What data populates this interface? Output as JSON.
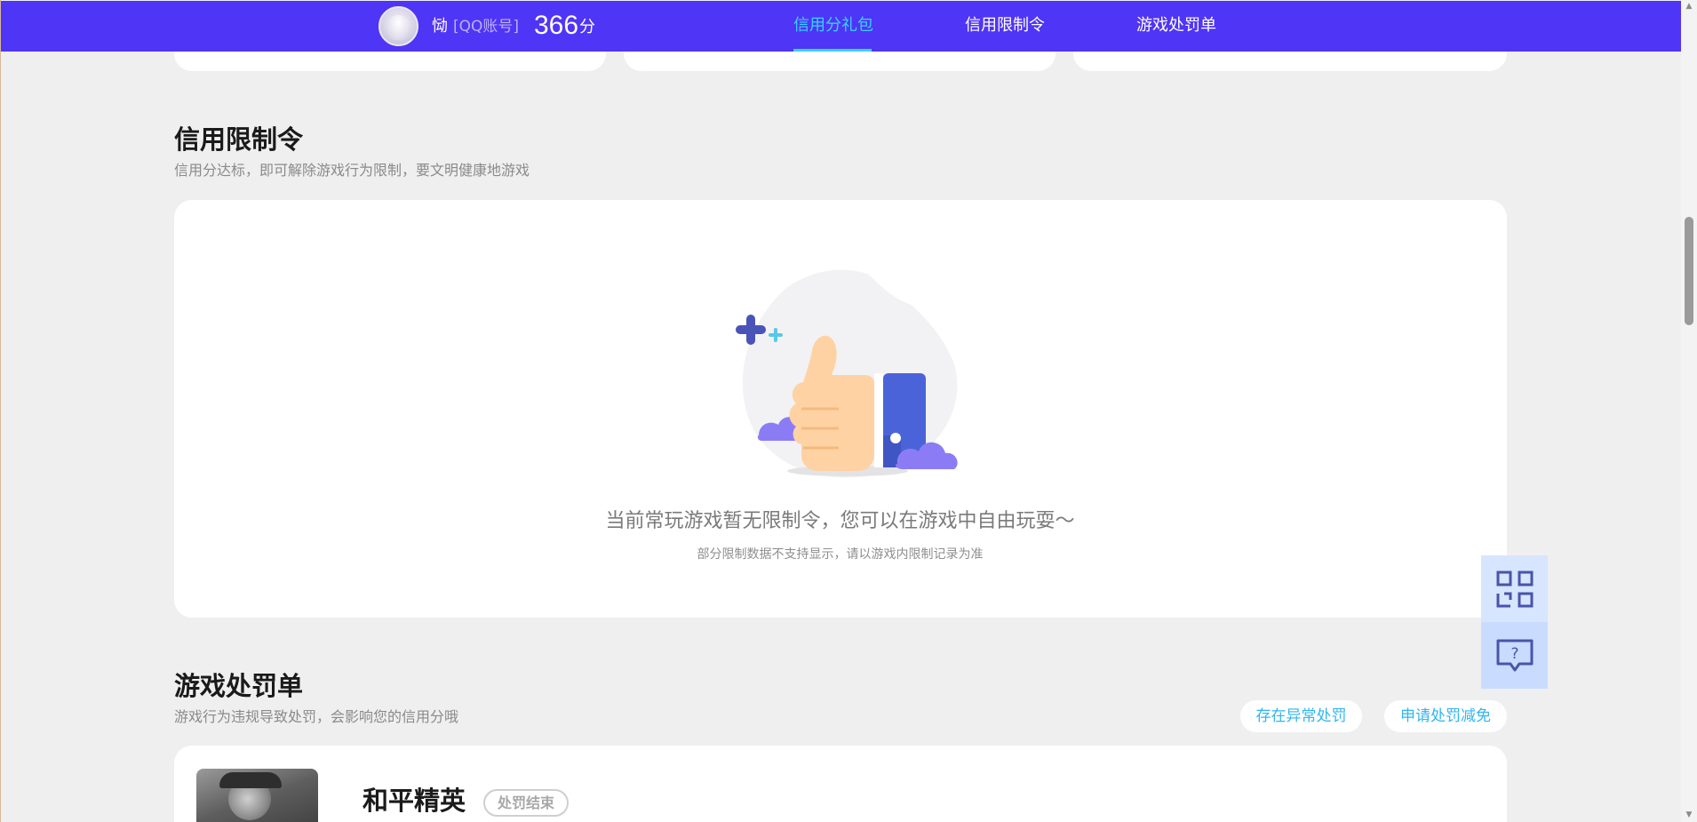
{
  "header": {
    "user_name": "恸",
    "account_type": "[QQ账号]",
    "score": "366",
    "score_unit": "分",
    "tabs": [
      {
        "label": "信用分礼包",
        "active": true
      },
      {
        "label": "信用限制令",
        "active": false
      },
      {
        "label": "游戏处罚单",
        "active": false
      }
    ]
  },
  "restriction_section": {
    "title": "信用限制令",
    "subtitle": "信用分达标，即可解除游戏行为限制，要文明健康地游戏",
    "empty_message": "当前常玩游戏暂无限制令，您可以在游戏中自由玩耍～",
    "empty_note": "部分限制数据不支持显示，请以游戏内限制记录为准"
  },
  "penalty_section": {
    "title": "游戏处罚单",
    "subtitle": "游戏行为违规导致处罚，会影响您的信用分哦",
    "abnormal_button": "存在异常处罚",
    "reduce_button": "申请处罚减免",
    "games": [
      {
        "name": "和平精英",
        "status": "处罚结束"
      }
    ]
  },
  "side_buttons": {
    "qr_icon": "qr-code-icon",
    "help_icon": "help-chat-icon"
  },
  "colors": {
    "header_bg": "#4f35f5",
    "accent": "#37d3ff",
    "link": "#2fb6f0",
    "page_bg": "#efefef"
  }
}
